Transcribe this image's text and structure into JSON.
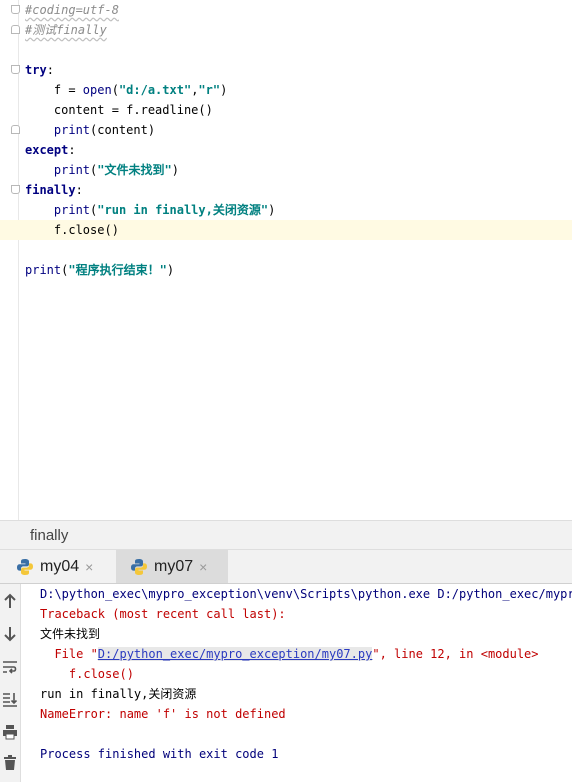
{
  "editor": {
    "lines": [
      {
        "id": "l1",
        "tokens": [
          {
            "t": "#coding=utf-8",
            "c": "cmt"
          }
        ]
      },
      {
        "id": "l2",
        "tokens": [
          {
            "t": "#测试finally",
            "c": "cmt"
          }
        ]
      },
      {
        "id": "l3",
        "tokens": []
      },
      {
        "id": "l4",
        "tokens": [
          {
            "t": "try",
            "c": "kw"
          },
          {
            "t": ":",
            "c": ""
          }
        ]
      },
      {
        "id": "l5",
        "tokens": [
          {
            "t": "    f = ",
            "c": ""
          },
          {
            "t": "open",
            "c": "fn"
          },
          {
            "t": "(",
            "c": ""
          },
          {
            "t": "\"d:/a.txt\"",
            "c": "str"
          },
          {
            "t": ",",
            "c": ""
          },
          {
            "t": "\"r\"",
            "c": "str"
          },
          {
            "t": ")",
            "c": ""
          }
        ]
      },
      {
        "id": "l6",
        "tokens": [
          {
            "t": "    content = f.readline()",
            "c": ""
          }
        ]
      },
      {
        "id": "l7",
        "tokens": [
          {
            "t": "    ",
            "c": ""
          },
          {
            "t": "print",
            "c": "fn"
          },
          {
            "t": "(content)",
            "c": ""
          }
        ]
      },
      {
        "id": "l8",
        "tokens": [
          {
            "t": "except",
            "c": "kw"
          },
          {
            "t": ":",
            "c": ""
          }
        ]
      },
      {
        "id": "l9",
        "tokens": [
          {
            "t": "    ",
            "c": ""
          },
          {
            "t": "print",
            "c": "fn"
          },
          {
            "t": "(",
            "c": ""
          },
          {
            "t": "\"文件未找到\"",
            "c": "str"
          },
          {
            "t": ")",
            "c": ""
          }
        ]
      },
      {
        "id": "l10",
        "tokens": [
          {
            "t": "finally",
            "c": "kw"
          },
          {
            "t": ":",
            "c": ""
          }
        ]
      },
      {
        "id": "l11",
        "tokens": [
          {
            "t": "    ",
            "c": ""
          },
          {
            "t": "print",
            "c": "fn"
          },
          {
            "t": "(",
            "c": ""
          },
          {
            "t": "\"run in finally,关闭资源\"",
            "c": "str"
          },
          {
            "t": ")",
            "c": ""
          }
        ]
      },
      {
        "id": "l12",
        "tokens": [
          {
            "t": "    f.close()",
            "c": ""
          }
        ]
      },
      {
        "id": "l13",
        "tokens": []
      },
      {
        "id": "l14",
        "tokens": [
          {
            "t": "print",
            "c": "fn"
          },
          {
            "t": "(",
            "c": ""
          },
          {
            "t": "\"程序执行结束！\"",
            "c": "str"
          },
          {
            "t": ")",
            "c": ""
          }
        ]
      }
    ]
  },
  "breadcrumb": {
    "label": "finally"
  },
  "run_tabs": [
    {
      "label": "my04",
      "close": "×"
    },
    {
      "label": "my07",
      "close": "×"
    }
  ],
  "console": {
    "cmd": "D:\\python_exec\\mypro_exception\\venv\\Scripts\\python.exe D:/python_exec/mypro_",
    "traceback": "Traceback (most recent call last):",
    "out1": "文件未找到",
    "file_prefix": "  File \"",
    "file_link": "D:/python_exec/mypro_exception/my07.py",
    "file_suffix": "\", line 12, in <module>",
    "code_line": "    f.close()",
    "out2": "run in finally,关闭资源",
    "error": "NameError: name 'f' is not defined",
    "finished": "Process finished with exit code 1"
  },
  "sidebar_icons": [
    "arrow-up-icon",
    "arrow-down-icon",
    "soft-wrap-icon",
    "scroll-to-end-icon",
    "print-icon",
    "trash-icon"
  ]
}
